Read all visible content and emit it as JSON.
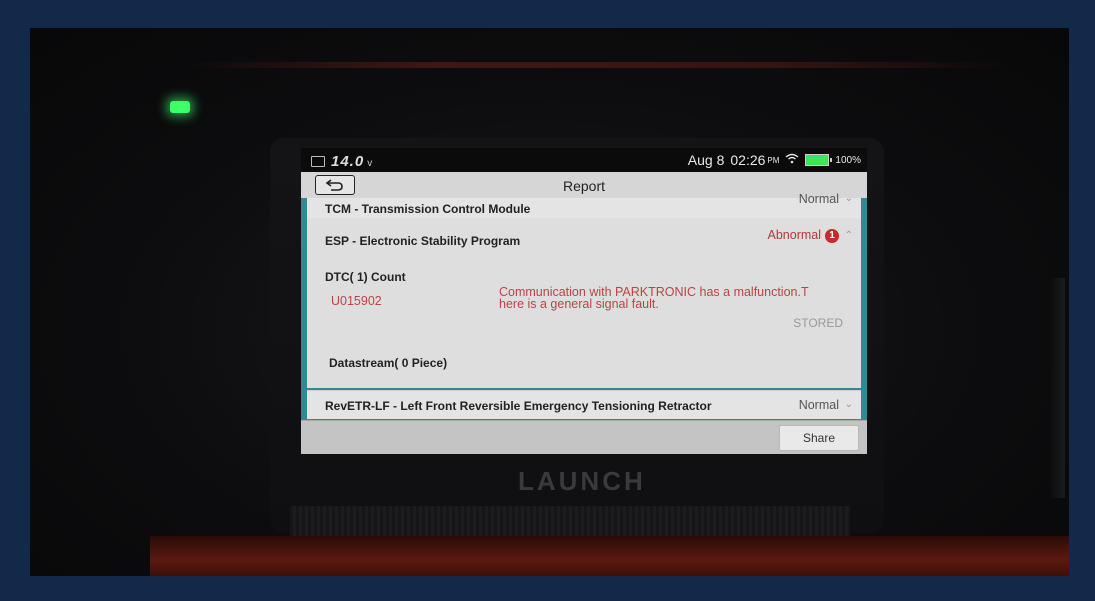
{
  "status_bar": {
    "voltage": "14.0",
    "voltage_unit": "v",
    "date": "Aug 8",
    "time": "02:26",
    "am_pm": "PM",
    "battery_pct": "100%"
  },
  "header": {
    "title": "Report"
  },
  "modules": [
    {
      "label": "TCM - Transmission Control Module",
      "status": "Normal"
    },
    {
      "label": "ESP - Electronic Stability Program",
      "status": "Abnormal",
      "badge": "1"
    },
    {
      "label": "RevETR-LF - Left Front Reversible Emergency Tensioning Retractor",
      "status": "Normal"
    }
  ],
  "esp_detail": {
    "dtc_header": "DTC( 1) Count",
    "dtc_code": "U015902",
    "dtc_desc_line1": "Communication with PARKTRONIC has a malfunction.T",
    "dtc_desc_line2": "here is a general signal fault.",
    "dtc_status": "STORED",
    "datastream_header": "Datastream( 0 Piece)"
  },
  "footer": {
    "share_label": "Share"
  },
  "device": {
    "brand": "LAUNCH"
  },
  "colors": {
    "abnormal": "#b03a3a",
    "badge": "#c62a2a",
    "accent_teal": "#2f8a93",
    "battery_green": "#3ee45a"
  }
}
